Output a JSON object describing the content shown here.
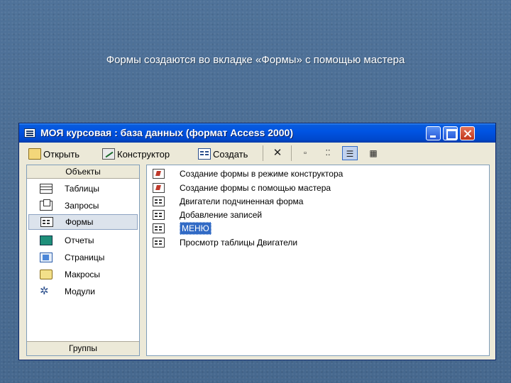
{
  "slide": {
    "title": "Формы создаются во вкладке «Формы» с помощью мастера"
  },
  "window": {
    "title": "МОЯ курсовая : база данных (формат Access 2000)",
    "toolbar": {
      "open_label": "Открыть",
      "design_label": "Конструктор",
      "create_label": "Создать",
      "icons": [
        "delete-icon",
        "large-icons-view-icon",
        "small-icons-view-icon",
        "list-view-icon",
        "details-view-icon"
      ],
      "active_view": "list-view-icon"
    },
    "left_pane": {
      "header": "Объекты",
      "footer": "Группы",
      "items": [
        {
          "label": "Таблицы",
          "icon": "table-icon"
        },
        {
          "label": "Запросы",
          "icon": "query-icon"
        },
        {
          "label": "Формы",
          "icon": "form-icon",
          "selected": true
        },
        {
          "label": "Отчеты",
          "icon": "report-icon"
        },
        {
          "label": "Страницы",
          "icon": "page-icon"
        },
        {
          "label": "Макросы",
          "icon": "macro-icon"
        },
        {
          "label": "Модули",
          "icon": "module-icon"
        }
      ]
    },
    "right_pane": {
      "items": [
        {
          "label": "Создание формы в режиме конструктора",
          "icon": "wizard-shortcut-icon"
        },
        {
          "label": "Создание формы с помощью мастера",
          "icon": "wizard-shortcut-icon"
        },
        {
          "label": "Двигатели подчиненная форма",
          "icon": "form-icon"
        },
        {
          "label": "Добавление записей",
          "icon": "form-icon"
        },
        {
          "label": "МЕНЮ",
          "icon": "form-icon",
          "selected": true
        },
        {
          "label": "Просмотр таблицы Двигатели",
          "icon": "form-icon"
        }
      ]
    },
    "colors": {
      "titlebar": "#0054e3",
      "selection": "#316ac5",
      "window_bg": "#ece9d8"
    }
  }
}
